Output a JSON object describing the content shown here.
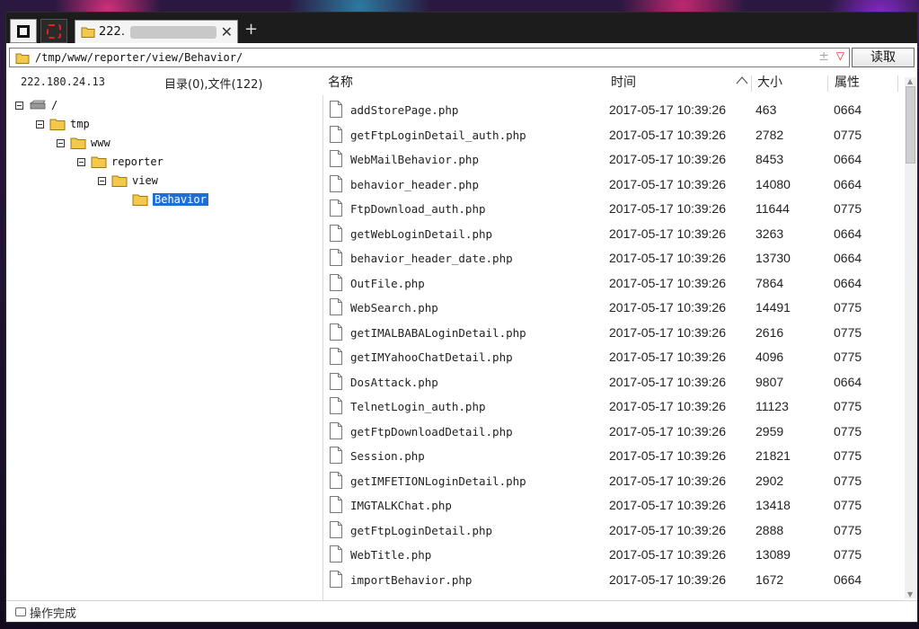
{
  "tabs": [
    {
      "label": "222."
    }
  ],
  "address": {
    "path": "/tmp/www/reporter/view/Behavior/",
    "extra_glyph": "±",
    "read_label": "读取"
  },
  "left": {
    "ip": "222.180.24.13",
    "summary": "目录(0),文件(122)"
  },
  "tree": [
    {
      "label": "/",
      "depth": 0,
      "type": "drive"
    },
    {
      "label": "tmp",
      "depth": 1,
      "type": "folder"
    },
    {
      "label": "www",
      "depth": 2,
      "type": "folder"
    },
    {
      "label": "reporter",
      "depth": 3,
      "type": "folder"
    },
    {
      "label": "view",
      "depth": 4,
      "type": "folder"
    },
    {
      "label": "Behavior",
      "depth": 5,
      "type": "folder",
      "selected": true
    }
  ],
  "columns": {
    "name": "名称",
    "time": "时间",
    "size": "大小",
    "attr": "属性"
  },
  "files": [
    {
      "name": "addStorePage.php",
      "time": "2017-05-17 10:39:26",
      "size": "463",
      "attr": "0664"
    },
    {
      "name": "getFtpLoginDetail_auth.php",
      "time": "2017-05-17 10:39:26",
      "size": "2782",
      "attr": "0775"
    },
    {
      "name": "WebMailBehavior.php",
      "time": "2017-05-17 10:39:26",
      "size": "8453",
      "attr": "0664"
    },
    {
      "name": "behavior_header.php",
      "time": "2017-05-17 10:39:26",
      "size": "14080",
      "attr": "0664"
    },
    {
      "name": "FtpDownload_auth.php",
      "time": "2017-05-17 10:39:26",
      "size": "11644",
      "attr": "0775"
    },
    {
      "name": "getWebLoginDetail.php",
      "time": "2017-05-17 10:39:26",
      "size": "3263",
      "attr": "0664"
    },
    {
      "name": "behavior_header_date.php",
      "time": "2017-05-17 10:39:26",
      "size": "13730",
      "attr": "0664"
    },
    {
      "name": "OutFile.php",
      "time": "2017-05-17 10:39:26",
      "size": "7864",
      "attr": "0664"
    },
    {
      "name": "WebSearch.php",
      "time": "2017-05-17 10:39:26",
      "size": "14491",
      "attr": "0775"
    },
    {
      "name": "getIMALBABALoginDetail.php",
      "time": "2017-05-17 10:39:26",
      "size": "2616",
      "attr": "0775"
    },
    {
      "name": "getIMYahooChatDetail.php",
      "time": "2017-05-17 10:39:26",
      "size": "4096",
      "attr": "0775"
    },
    {
      "name": "DosAttack.php",
      "time": "2017-05-17 10:39:26",
      "size": "9807",
      "attr": "0664"
    },
    {
      "name": "TelnetLogin_auth.php",
      "time": "2017-05-17 10:39:26",
      "size": "11123",
      "attr": "0775"
    },
    {
      "name": "getFtpDownloadDetail.php",
      "time": "2017-05-17 10:39:26",
      "size": "2959",
      "attr": "0775"
    },
    {
      "name": "Session.php",
      "time": "2017-05-17 10:39:26",
      "size": "21821",
      "attr": "0775"
    },
    {
      "name": "getIMFETIONLoginDetail.php",
      "time": "2017-05-17 10:39:26",
      "size": "2902",
      "attr": "0775"
    },
    {
      "name": "IMGTALKChat.php",
      "time": "2017-05-17 10:39:26",
      "size": "13418",
      "attr": "0775"
    },
    {
      "name": "getFtpLoginDetail.php",
      "time": "2017-05-17 10:39:26",
      "size": "2888",
      "attr": "0775"
    },
    {
      "name": "WebTitle.php",
      "time": "2017-05-17 10:39:26",
      "size": "13089",
      "attr": "0775"
    },
    {
      "name": "importBehavior.php",
      "time": "2017-05-17 10:39:26",
      "size": "1672",
      "attr": "0664"
    }
  ],
  "status": {
    "text": "操作完成"
  },
  "colors": {
    "selection": "#1d6fd6",
    "folder": "#f2c94c",
    "accent_red": "#d22222"
  }
}
